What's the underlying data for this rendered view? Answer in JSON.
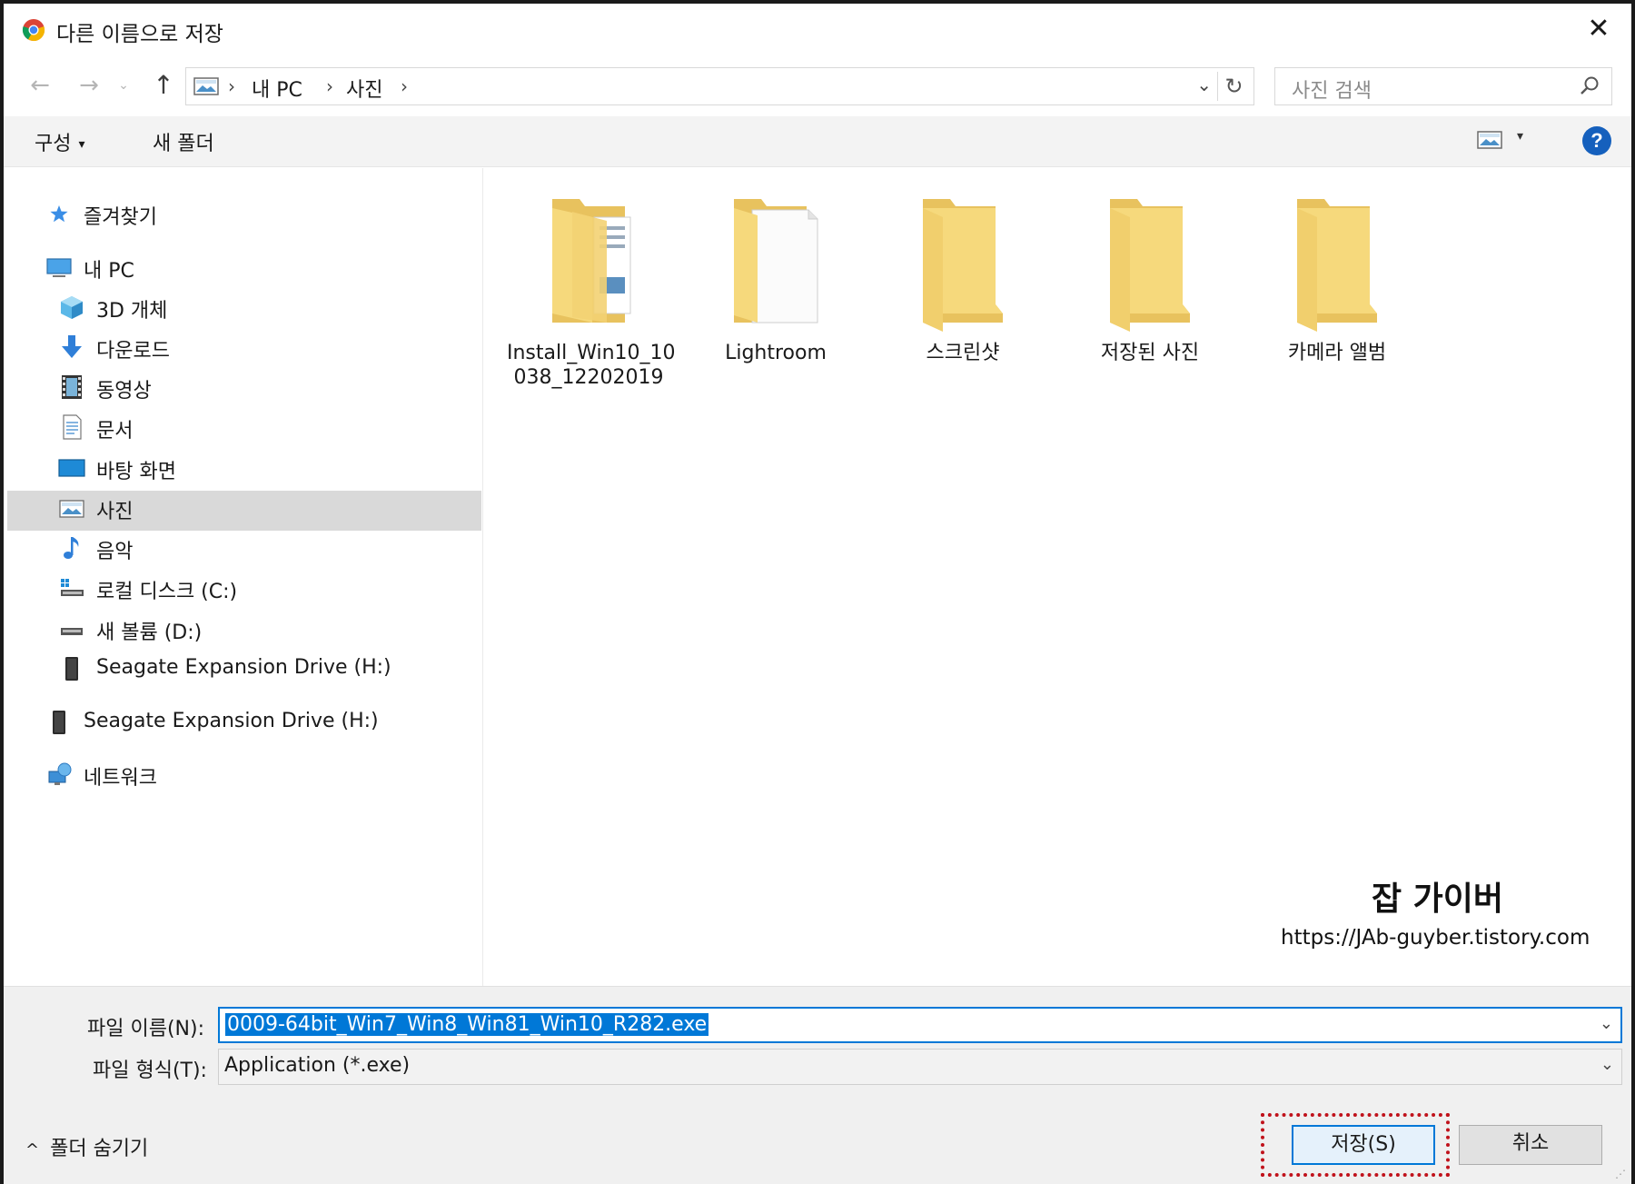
{
  "window": {
    "title": "다른 이름으로 저장",
    "close_glyph": "✕"
  },
  "address": {
    "back_glyph": "←",
    "forward_glyph": "→",
    "recent_glyph": "⌄",
    "up_glyph": "↑",
    "crumbs": [
      "내 PC",
      "사진"
    ],
    "separator": "›",
    "dropdown_glyph": "⌄",
    "refresh_glyph": "↻"
  },
  "search": {
    "placeholder": "사진 검색"
  },
  "toolbar": {
    "organize_label": "구성",
    "organize_caret": "▾",
    "new_folder_label": "새 폴더",
    "view_caret": "▾",
    "help_label": "?"
  },
  "nav": {
    "items": [
      {
        "label": "즐겨찾기",
        "icon": "star-icon"
      },
      {
        "label": "내 PC",
        "icon": "pc-icon"
      },
      {
        "label": "3D 개체",
        "icon": "cube-icon"
      },
      {
        "label": "다운로드",
        "icon": "download-icon"
      },
      {
        "label": "동영상",
        "icon": "video-icon"
      },
      {
        "label": "문서",
        "icon": "document-icon"
      },
      {
        "label": "바탕 화면",
        "icon": "desktop-icon"
      },
      {
        "label": "사진",
        "icon": "pictures-icon",
        "selected": true
      },
      {
        "label": "음악",
        "icon": "music-icon"
      },
      {
        "label": "로컬 디스크 (C:)",
        "icon": "local-disk-icon"
      },
      {
        "label": "새 볼륨 (D:)",
        "icon": "drive-icon"
      },
      {
        "label": "Seagate Expansion Drive (H:)",
        "icon": "external-drive-icon"
      },
      {
        "label": "Seagate Expansion Drive (H:)",
        "icon": "external-drive-icon"
      },
      {
        "label": "네트워크",
        "icon": "network-icon"
      }
    ]
  },
  "folders": [
    {
      "name_line1": "Install_Win10_10",
      "name_line2": "038_12202019"
    },
    {
      "name_line1": "Lightroom",
      "name_line2": ""
    },
    {
      "name_line1": "스크린샷",
      "name_line2": ""
    },
    {
      "name_line1": "저장된 사진",
      "name_line2": ""
    },
    {
      "name_line1": "카메라 앨범",
      "name_line2": ""
    }
  ],
  "watermark": {
    "title": "잡 가이버",
    "url": "https://JAb-guyber.tistory.com"
  },
  "form": {
    "filename_label": "파일 이름(N):",
    "filename_value": "0009-64bit_Win7_Win8_Win81_Win10_R282.exe",
    "filetype_label": "파일 형식(T):",
    "filetype_value": "Application (*.exe)",
    "chevron_glyph": "⌄"
  },
  "footer": {
    "hide_folders_caret": "^",
    "hide_folders_label": "폴더 숨기기",
    "save_label": "저장(S)",
    "cancel_label": "취소"
  },
  "colors": {
    "accent": "#0078d7",
    "highlight": "#c0121b",
    "selection": "#d9d9d9"
  }
}
